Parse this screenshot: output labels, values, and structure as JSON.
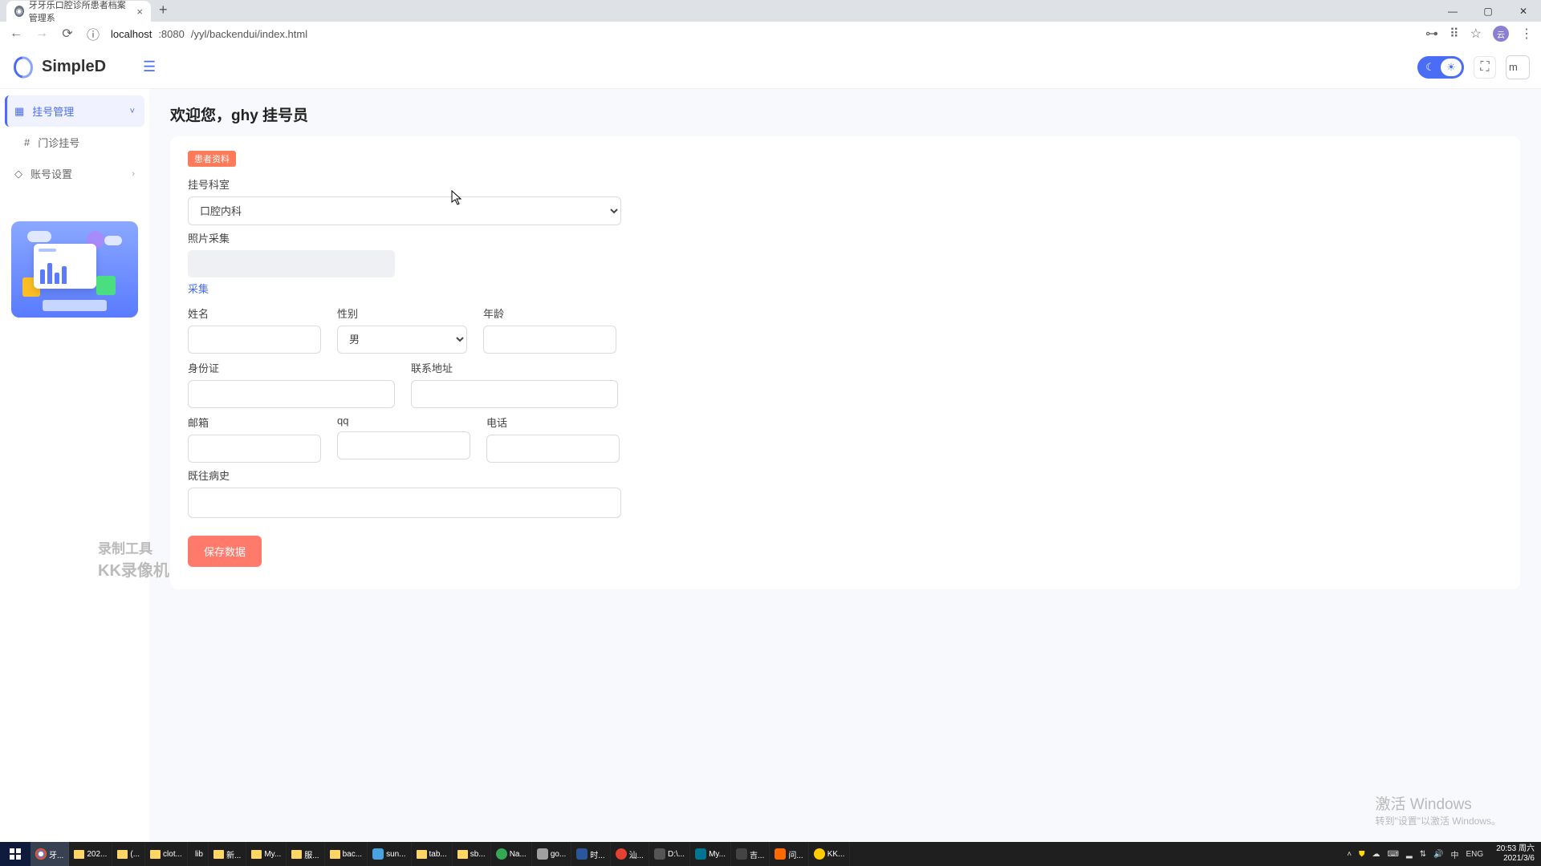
{
  "browser": {
    "tab_title": "牙牙乐口腔诊所患者档案管理系",
    "url_host": "localhost",
    "url_port": ":8080",
    "url_path": "/yyl/backendui/index.html"
  },
  "brand": "SimpleD",
  "sidebar": {
    "items": [
      {
        "label": "挂号管理",
        "chev": "˅"
      },
      {
        "label": "门诊挂号"
      },
      {
        "label": "账号设置",
        "chev": "›"
      }
    ]
  },
  "main": {
    "welcome": "欢迎您，ghy 挂号员",
    "badge": "患者资料",
    "labels": {
      "department": "挂号科室",
      "photo": "照片采集",
      "capture": "采集",
      "name": "姓名",
      "gender": "性别",
      "age": "年龄",
      "id_card": "身份证",
      "address": "联系地址",
      "email": "邮箱",
      "qq": "qq",
      "phone": "电话",
      "history": "既往病史"
    },
    "department_value": "口腔内科",
    "gender_value": "男",
    "save_button": "保存数据"
  },
  "watermark": {
    "line1": "录制工具",
    "line2": "KK录像机"
  },
  "winact": {
    "t1": "激活 Windows",
    "t2": "转到\"设置\"以激活 Windows。"
  },
  "taskbar": {
    "items": [
      "牙...",
      "202...",
      "(...",
      "clot...",
      "lib",
      "新...",
      "My...",
      "服...",
      "bac...",
      "sun...",
      "tab...",
      "sb...",
      "Na...",
      "go...",
      "时...",
      "汕...",
      "D:\\...",
      "My...",
      "吉...",
      "问...",
      "KK..."
    ],
    "ime": "中",
    "lang": "ENG",
    "time": "20:53 周六",
    "date": "2021/3/6"
  }
}
